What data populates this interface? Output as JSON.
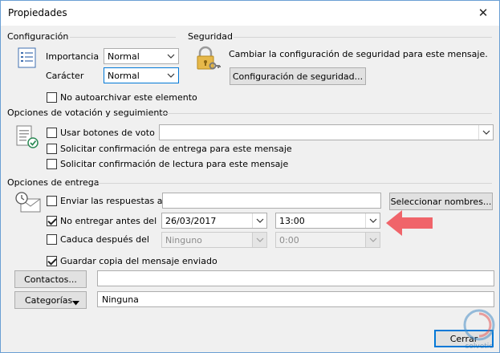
{
  "window": {
    "title": "Propiedades",
    "close_glyph": "✕"
  },
  "configuracion": {
    "section_title": "Configuración",
    "importancia_label": "Importancia",
    "importancia_value": "Normal",
    "caracter_label": "Carácter",
    "caracter_value": "Normal",
    "no_autoarchivar_label": "No autoarchivar este elemento",
    "no_autoarchivar_checked": false
  },
  "seguridad": {
    "section_title": "Seguridad",
    "description": "Cambiar la configuración de seguridad para este mensaje.",
    "button_label": "Configuración de seguridad..."
  },
  "votacion": {
    "section_title": "Opciones de votación y seguimiento",
    "usar_botones_label": "Usar botones de voto",
    "usar_botones_checked": false,
    "usar_botones_value": "",
    "confirm_entrega_label": "Solicitar confirmación de entrega para este mensaje",
    "confirm_entrega_checked": false,
    "confirm_lectura_label": "Solicitar confirmación de lectura para este mensaje",
    "confirm_lectura_checked": false
  },
  "entrega": {
    "section_title": "Opciones de entrega",
    "enviar_respuestas_label": "Enviar las respuestas a",
    "enviar_respuestas_checked": false,
    "enviar_respuestas_value": "",
    "seleccionar_nombres_label": "Seleccionar nombres...",
    "no_entregar_label": "No entregar antes del",
    "no_entregar_checked": true,
    "no_entregar_date": "26/03/2017",
    "no_entregar_time": "13:00",
    "caduca_label": "Caduca después del",
    "caduca_checked": false,
    "caduca_date": "Ninguno",
    "caduca_time": "0:00",
    "guardar_copia_label": "Guardar copia del mensaje enviado",
    "guardar_copia_checked": true
  },
  "contactos": {
    "button_label": "Contactos...",
    "value": ""
  },
  "categorias": {
    "button_label": "Categorías",
    "value": "Ninguna"
  },
  "footer": {
    "cerrar_label": "Cerrar"
  },
  "watermark": {
    "text": "solvetic"
  },
  "colors": {
    "accent": "#0078d7",
    "arrow": "#f0646a",
    "window_border": "#6a9fd4"
  }
}
